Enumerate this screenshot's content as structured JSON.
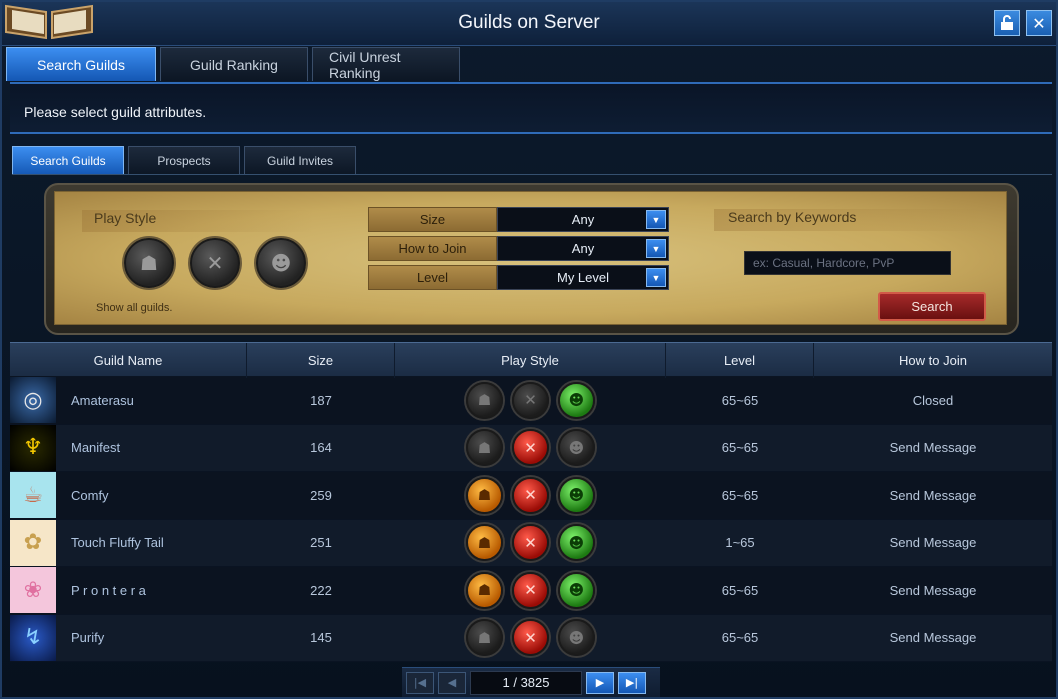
{
  "window": {
    "title": "Guilds on Server",
    "lock_icon": "lock-icon",
    "close_icon": "close-icon"
  },
  "top_tabs": [
    {
      "label": "Search Guilds",
      "active": true
    },
    {
      "label": "Guild Ranking",
      "active": false
    },
    {
      "label": "Civil Unrest Ranking",
      "active": false
    }
  ],
  "info_text": "Please select guild attributes.",
  "sub_tabs": [
    {
      "label": "Search Guilds",
      "active": true
    },
    {
      "label": "Prospects",
      "active": false
    },
    {
      "label": "Guild Invites",
      "active": false
    }
  ],
  "filters": {
    "play_style_label": "Play Style",
    "size_label": "Size",
    "size_value": "Any",
    "join_label": "How to Join",
    "join_value": "Any",
    "level_label": "Level",
    "level_value": "My Level",
    "keywords_label": "Search by Keywords",
    "keywords_placeholder": "ex: Casual, Hardcore, PvP",
    "show_all": "Show all guilds.",
    "search_button": "Search"
  },
  "table": {
    "headers": [
      "Guild Name",
      "Size",
      "Play Style",
      "Level",
      "How to Join"
    ],
    "rows": [
      {
        "name": "Amaterasu",
        "size": "187",
        "pve": "off",
        "pvp": "off",
        "social": "green",
        "level": "65~65",
        "join": "Closed"
      },
      {
        "name": "Manifest",
        "size": "164",
        "pve": "off",
        "pvp": "red",
        "social": "off",
        "level": "65~65",
        "join": "Send Message"
      },
      {
        "name": "Comfy",
        "size": "259",
        "pve": "orange",
        "pvp": "red",
        "social": "green",
        "level": "65~65",
        "join": "Send Message"
      },
      {
        "name": "Touch Fluffy Tail",
        "size": "251",
        "pve": "orange",
        "pvp": "red",
        "social": "green",
        "level": "1~65",
        "join": "Send Message"
      },
      {
        "name": "P r o n t e r a",
        "size": "222",
        "pve": "orange",
        "pvp": "red",
        "social": "green",
        "level": "65~65",
        "join": "Send Message"
      },
      {
        "name": "Purify",
        "size": "145",
        "pve": "off",
        "pvp": "red",
        "social": "off",
        "level": "65~65",
        "join": "Send Message"
      }
    ]
  },
  "pagination": {
    "current": "1 / 3825"
  }
}
